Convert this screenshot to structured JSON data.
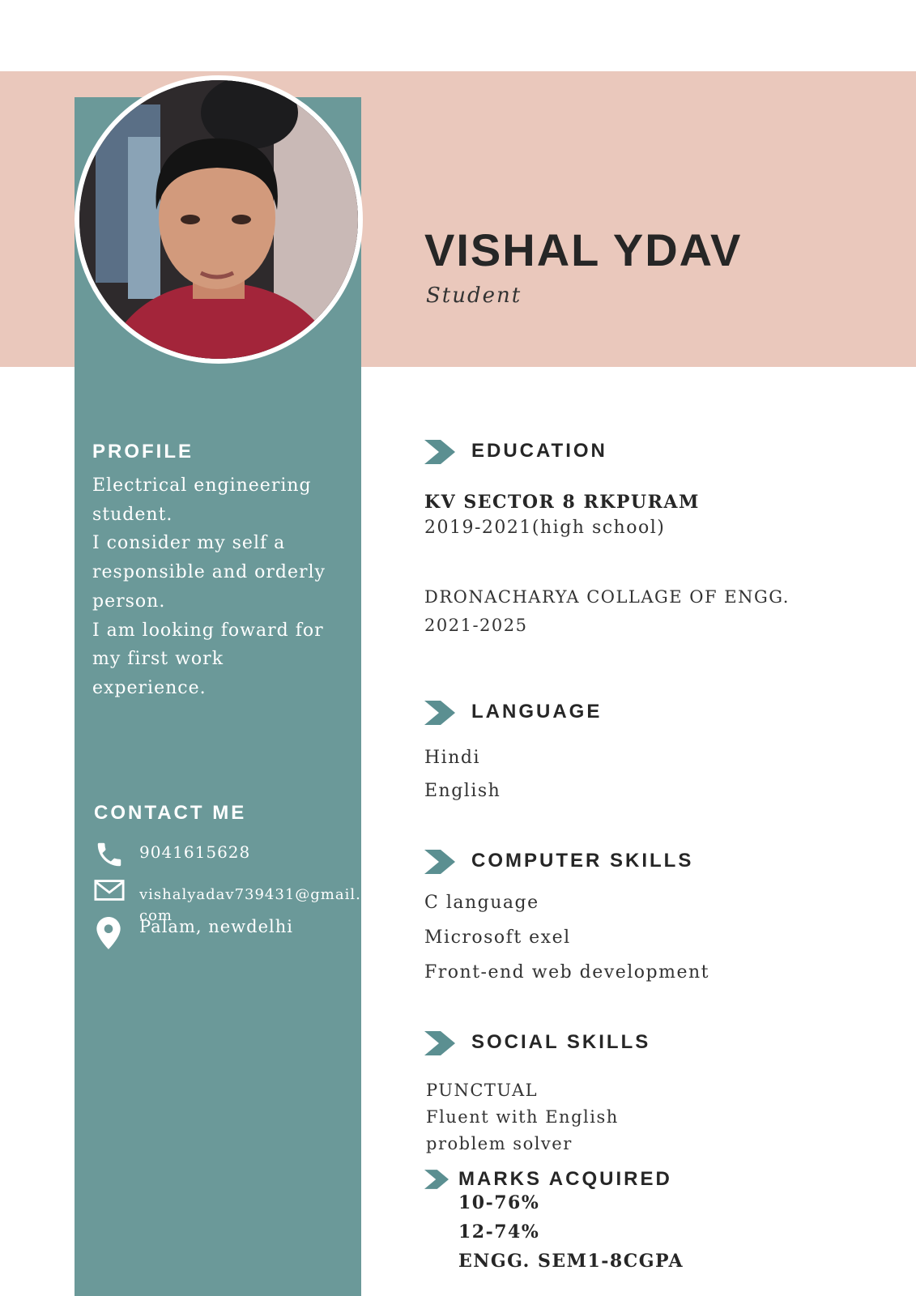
{
  "header": {
    "name": "VISHAL YDAV",
    "role": "Student"
  },
  "profile": {
    "heading": "PROFILE",
    "lines": [
      "Electrical engineering",
      "student.",
      "I consider my self a",
      "responsible and orderly",
      "person.",
      "I am looking foward for",
      "my first work",
      "experience."
    ]
  },
  "contact": {
    "heading": "CONTACT ME",
    "phone": "9041615628",
    "email": "vishalyadav739431@gmail.com",
    "address": "Palam, newdelhi",
    "icons": {
      "phone": "phone-icon",
      "email": "envelope-icon",
      "address": "map-pin-icon"
    }
  },
  "education": {
    "heading": "EDUCATION",
    "entries": [
      {
        "school": "KV SECTOR 8 RKPURAM",
        "years": "2019-2021(high school)"
      },
      {
        "school": "DRONACHARYA COLLAGE OF ENGG.",
        "years": "2021-2025"
      }
    ]
  },
  "language": {
    "heading": "LANGUAGE",
    "items": [
      "Hindi",
      "English"
    ]
  },
  "computer_skills": {
    "heading": "COMPUTER SKILLS",
    "items": [
      "C language",
      "Microsoft exel",
      "Front-end web development"
    ]
  },
  "social_skills": {
    "heading": "SOCIAL SKILLS",
    "items": [
      "PUNCTUAL",
      "Fluent with English",
      "problem solver"
    ]
  },
  "marks": {
    "heading": "MARKS ACQUIRED",
    "items": [
      "10-76%",
      "12-74%",
      "ENGG. SEM1-8CGPA"
    ]
  },
  "colors": {
    "header_band": "#eac8bc",
    "sidebar": "#6b9999",
    "chevron": "#5b8f91",
    "heading_text": "#262626"
  }
}
